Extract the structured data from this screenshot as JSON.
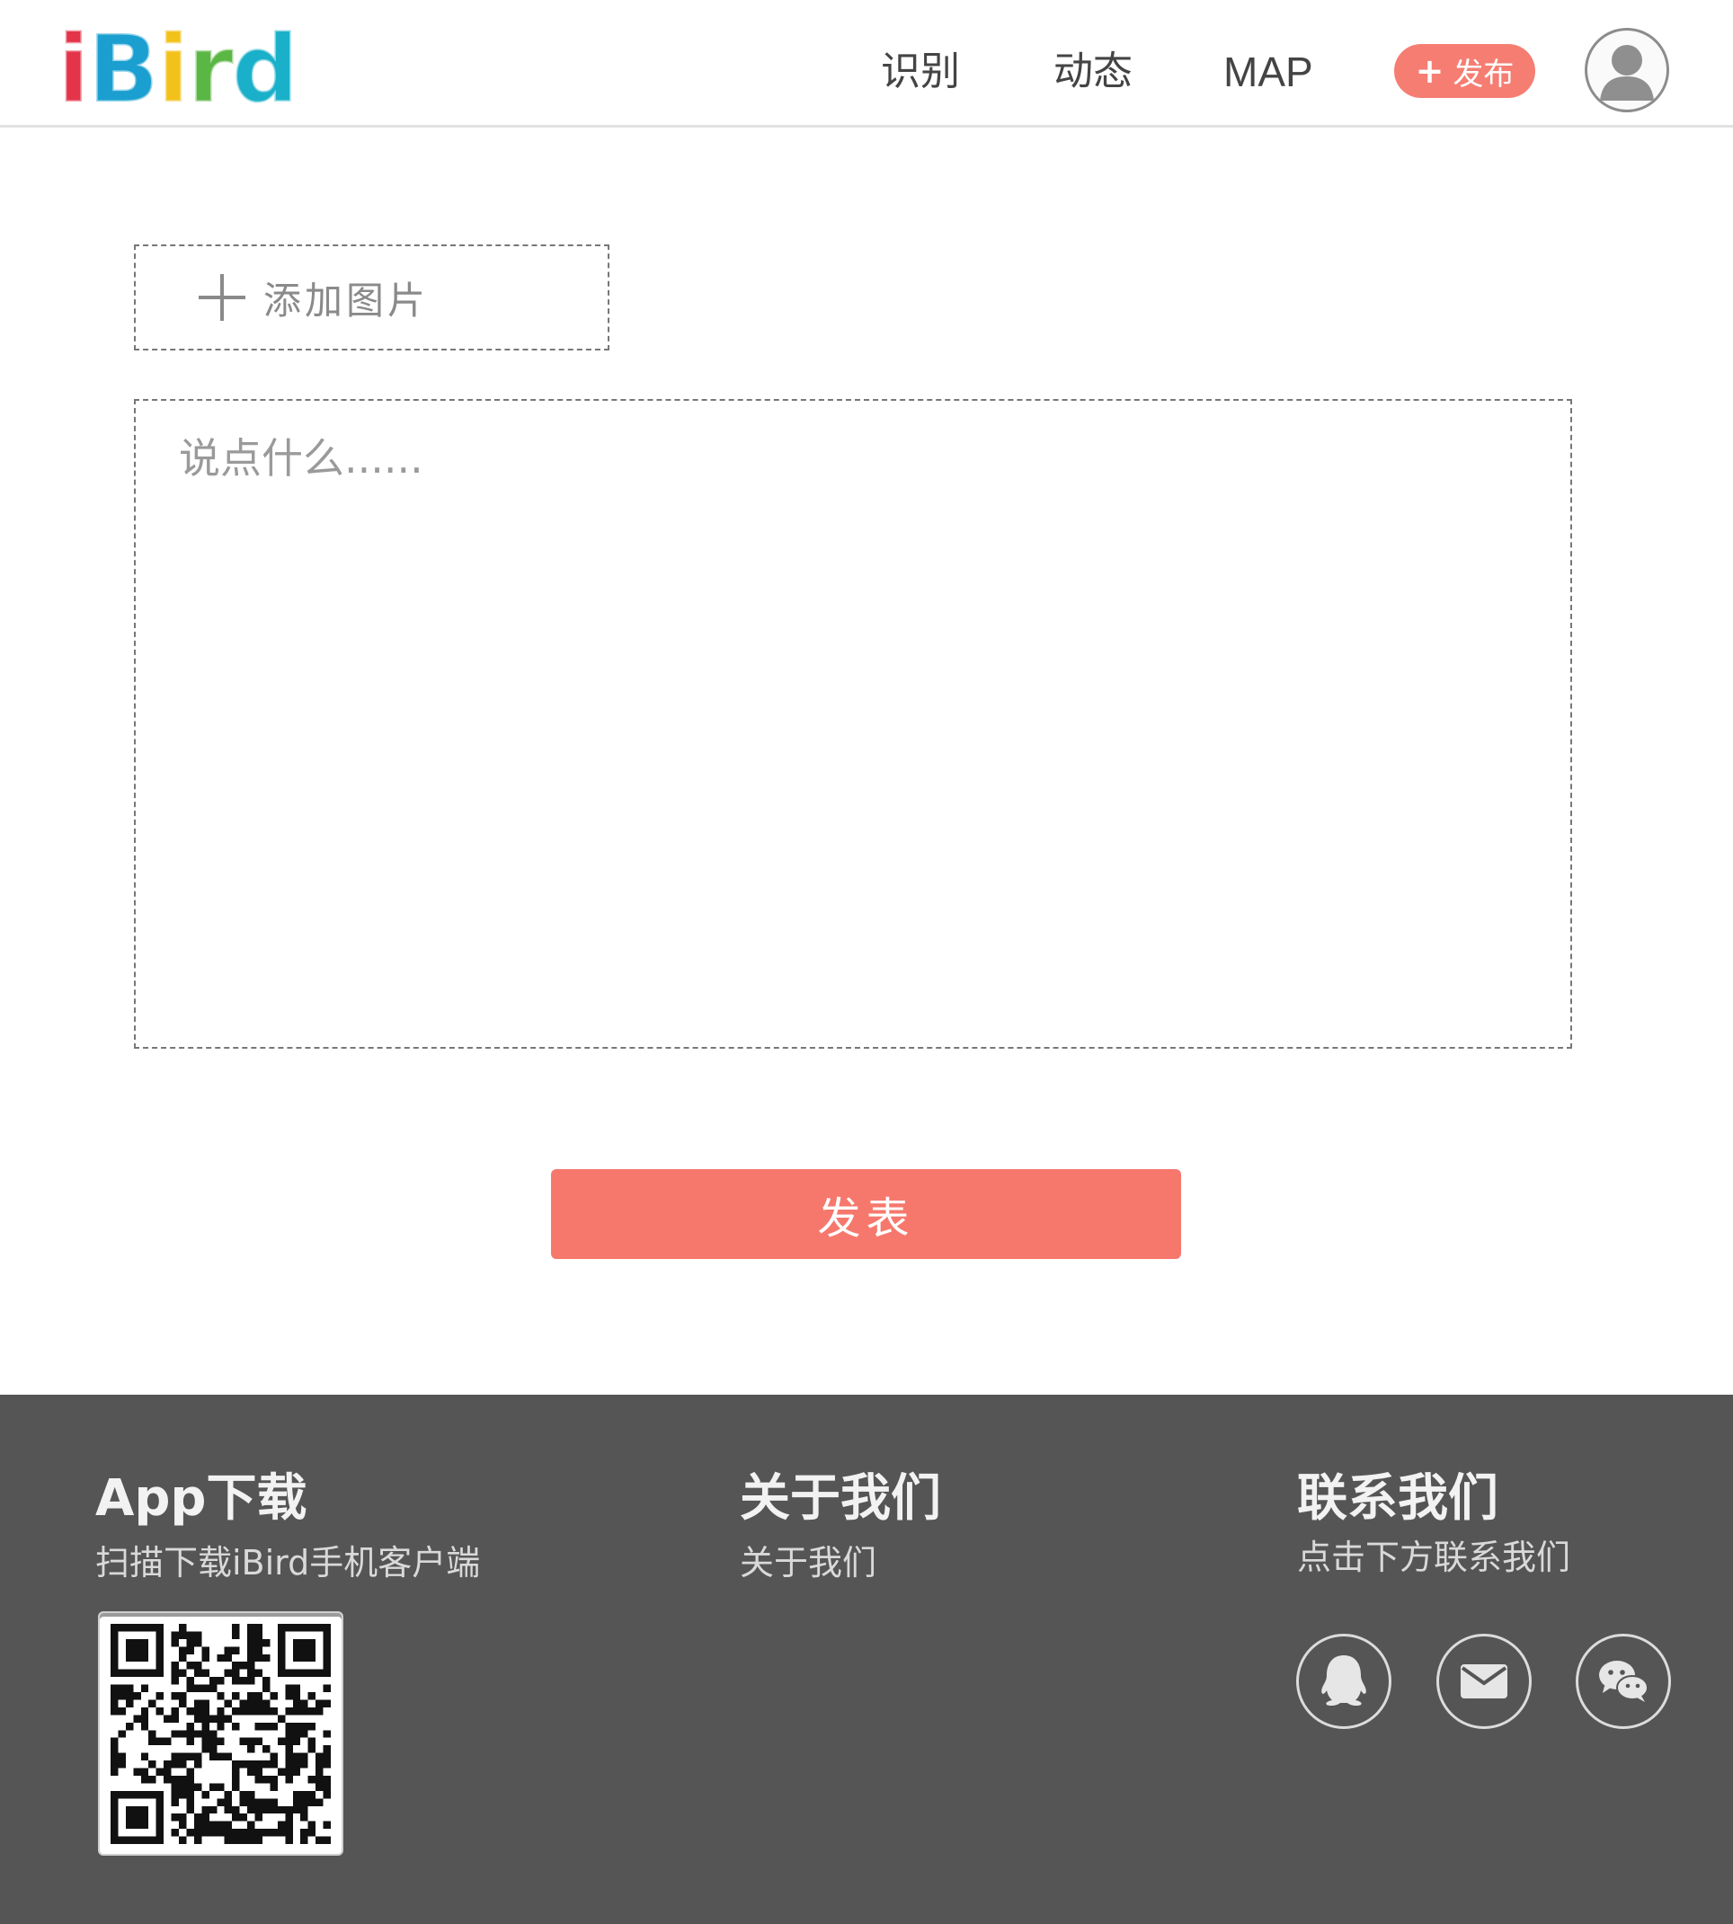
{
  "header": {
    "logo": {
      "letters": [
        "i",
        "B",
        "i",
        "r",
        "d"
      ],
      "colors": [
        "#e3344a",
        "#1a9fd0",
        "#f2c21b",
        "#5bb744",
        "#1bb0c9"
      ]
    },
    "nav": {
      "recognize": "识别",
      "feed": "动态",
      "map": "MAP"
    },
    "publish": {
      "icon": "plus-icon",
      "label": "发布",
      "color": "#f67d72"
    },
    "avatar": {
      "icon": "user-icon"
    }
  },
  "compose": {
    "add_image": {
      "icon": "plus-icon",
      "label": "添加图片"
    },
    "textarea": {
      "placeholder": "说点什么......",
      "value": ""
    },
    "submit": {
      "label": "发表",
      "color": "#f6786d"
    }
  },
  "footer": {
    "background": "#555555",
    "download": {
      "title": "App下载",
      "subtitle": "扫描下载iBird手机客户端",
      "qr_icon": "qr-code"
    },
    "about": {
      "title": "关于我们",
      "link": "关于我们"
    },
    "contact": {
      "title": "联系我们",
      "subtitle": "点击下方联系我们",
      "icons": [
        "qq-icon",
        "mail-icon",
        "wechat-icon"
      ]
    }
  }
}
